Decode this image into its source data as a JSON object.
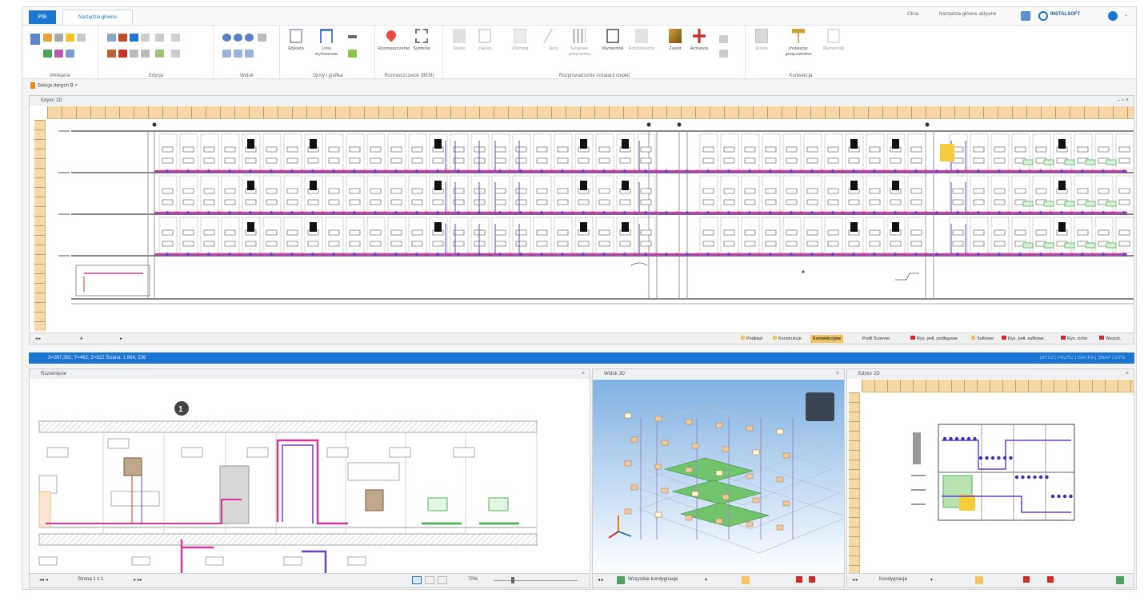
{
  "ribbon": {
    "file_tab": "Plik",
    "home_tab": "Narzędzia główne",
    "right_view": "Okna",
    "right_style": "Narzędzia  główne  aktywne",
    "brand": "INSTALSOFT",
    "groups": [
      {
        "label": "Wklejanie"
      },
      {
        "label": "Edycja"
      },
      {
        "label": "Widok"
      },
      {
        "label": "Opisy i grafika"
      },
      {
        "label": "Rozmieszczenie (BEM)"
      },
      {
        "label": "Rozprowadzenie  instalacji  ciepłej"
      },
      {
        "label": "Konwekcja"
      }
    ],
    "buttons": {
      "labels": "Etykieta",
      "lines": "Linia wymiarowa",
      "placement": "Rozmieszczenie",
      "symbols": "Symbole",
      "grid": "Siatka",
      "range": "Zakres",
      "define": "Zdefiniuj",
      "pipes": "Rury",
      "groups": "Grupowe połączenia",
      "sources": "Wymiennik",
      "collectors": "Rozdzielacze",
      "devices": "Zawór",
      "fittings": "Armatura",
      "boiler": "Kocioł",
      "collectors2": "Kolektory",
      "install": "Instalacje gorącowodne",
      "exchange": "Wymiennik"
    }
  },
  "doc_tab": "Sekcja danych B",
  "pane_top": {
    "title": "Edytor 2D",
    "sheet_tabs": [
      {
        "label": "Podkład",
        "style": "ylw"
      },
      {
        "label": "Konstrukcje",
        "style": "ylw"
      },
      {
        "label": "Konwekcyjne",
        "style": "active"
      },
      {
        "label": "Profil Ścienne",
        "style": "plain"
      },
      {
        "label": "Rys. pełt. podłogowe",
        "style": "red"
      },
      {
        "label": "Sufitowe",
        "style": "ylw"
      },
      {
        "label": "Rys. pełt. sufitowe",
        "style": "red"
      },
      {
        "label": "Rys. ciche",
        "style": "red"
      },
      {
        "label": "Wszyst.",
        "style": "red"
      }
    ],
    "scroll_label": "A"
  },
  "status": {
    "coords": "X=397,382; Y=462; Z=622  Ścianа: 1 864, 236",
    "right": "ORTO  |  PRZYC  |  SIATKA  |  SNAP  |  DYN"
  },
  "pane_elev": {
    "title": "Rozwinięcie",
    "marker": "1",
    "page_label": "Strona 1 z 1",
    "zoom": "70%"
  },
  "pane_3d": {
    "title": "Widok 3D",
    "dropdown": "Wszystkie kondygnacje"
  },
  "pane_small": {
    "title": "Edytor 2D",
    "dropdown": "Kondygnacja"
  },
  "colors": {
    "accent": "#1a76d2",
    "pipe_supply": "#d8359a",
    "pipe_return": "#6a3fc7",
    "ruler": "#f7d9a8",
    "heater": "#54b55e",
    "highlight": "#f5cc3a"
  }
}
